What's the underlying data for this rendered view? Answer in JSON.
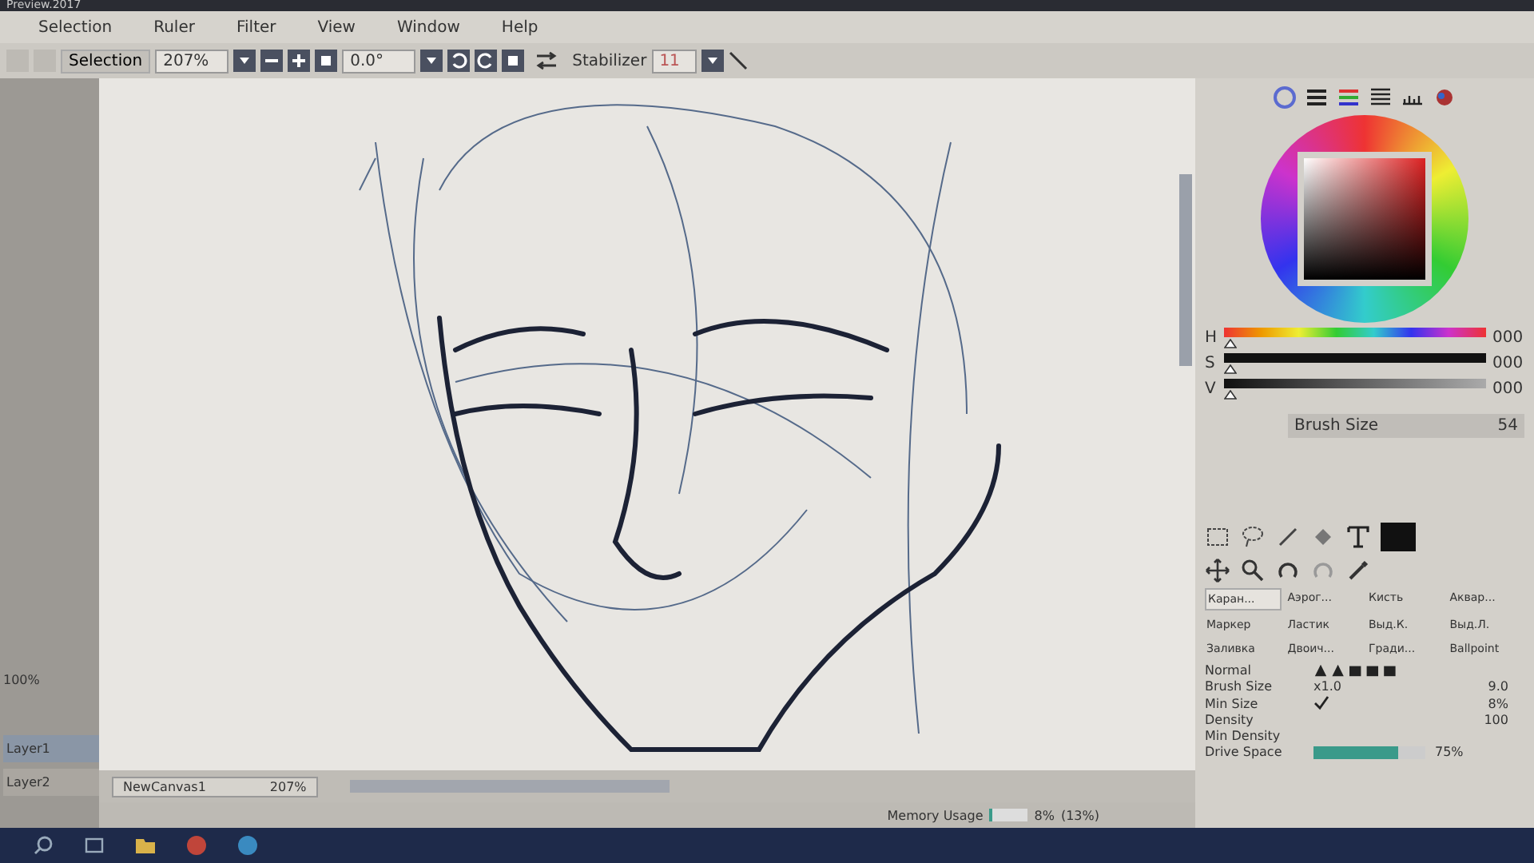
{
  "window": {
    "title": "Preview.2017"
  },
  "menu": [
    {
      "label": "Selection"
    },
    {
      "label": "Ruler"
    },
    {
      "label": "Filter"
    },
    {
      "label": "View"
    },
    {
      "label": "Window"
    },
    {
      "label": "Help"
    }
  ],
  "toolbar": {
    "selection_label": "Selection",
    "zoom": "207%",
    "angle": "0.0°",
    "stabilizer_label": "Stabilizer",
    "stabilizer": "11"
  },
  "left_panel": {
    "opacity": "100%",
    "layers": [
      {
        "name": "Layer1",
        "selected": true
      },
      {
        "name": "Layer2",
        "selected": false
      }
    ]
  },
  "color": {
    "sliders": [
      {
        "label": "H",
        "level": 0,
        "reading": "000",
        "kind": "hue"
      },
      {
        "label": "S",
        "level": 0,
        "reading": "000",
        "kind": "sat"
      },
      {
        "label": "V",
        "level": 0,
        "reading": "000",
        "kind": "val"
      }
    ]
  },
  "brush_size": {
    "label": "Brush Size",
    "value": "54"
  },
  "brushes": [
    {
      "label": "Каран...",
      "selected": true
    },
    {
      "label": "Аэрог...",
      "selected": false
    },
    {
      "label": "Кисть",
      "selected": false
    },
    {
      "label": "Аквар...",
      "selected": false
    },
    {
      "label": "Маркер",
      "selected": false
    },
    {
      "label": "Ластик",
      "selected": false
    },
    {
      "label": "Выд.К.",
      "selected": false
    },
    {
      "label": "Выд.Л.",
      "selected": false
    },
    {
      "label": "Заливка",
      "selected": false
    },
    {
      "label": "Двоич...",
      "selected": false
    },
    {
      "label": "Гради...",
      "selected": false
    },
    {
      "label": "Ballpoint",
      "selected": false
    }
  ],
  "settings": [
    {
      "kind": "mode",
      "label": "Normal"
    },
    {
      "kind": "value",
      "label": "Brush Size",
      "extra": "x1.0",
      "value": "9.0"
    },
    {
      "kind": "check",
      "label": "Min Size",
      "checked": true,
      "value": "8%"
    },
    {
      "kind": "value",
      "label": "Density",
      "value": "100"
    },
    {
      "kind": "plain",
      "label": "Min Density"
    },
    {
      "kind": "bar",
      "label": "Drive Space",
      "level": 0.75,
      "value": "75%"
    }
  ],
  "canvas_tab": {
    "name": "NewCanvas1",
    "zoom": "207%"
  },
  "status_bar": {
    "label": "Memory Usage",
    "level": 0.08,
    "value": "8%",
    "extra": "(13%)"
  }
}
